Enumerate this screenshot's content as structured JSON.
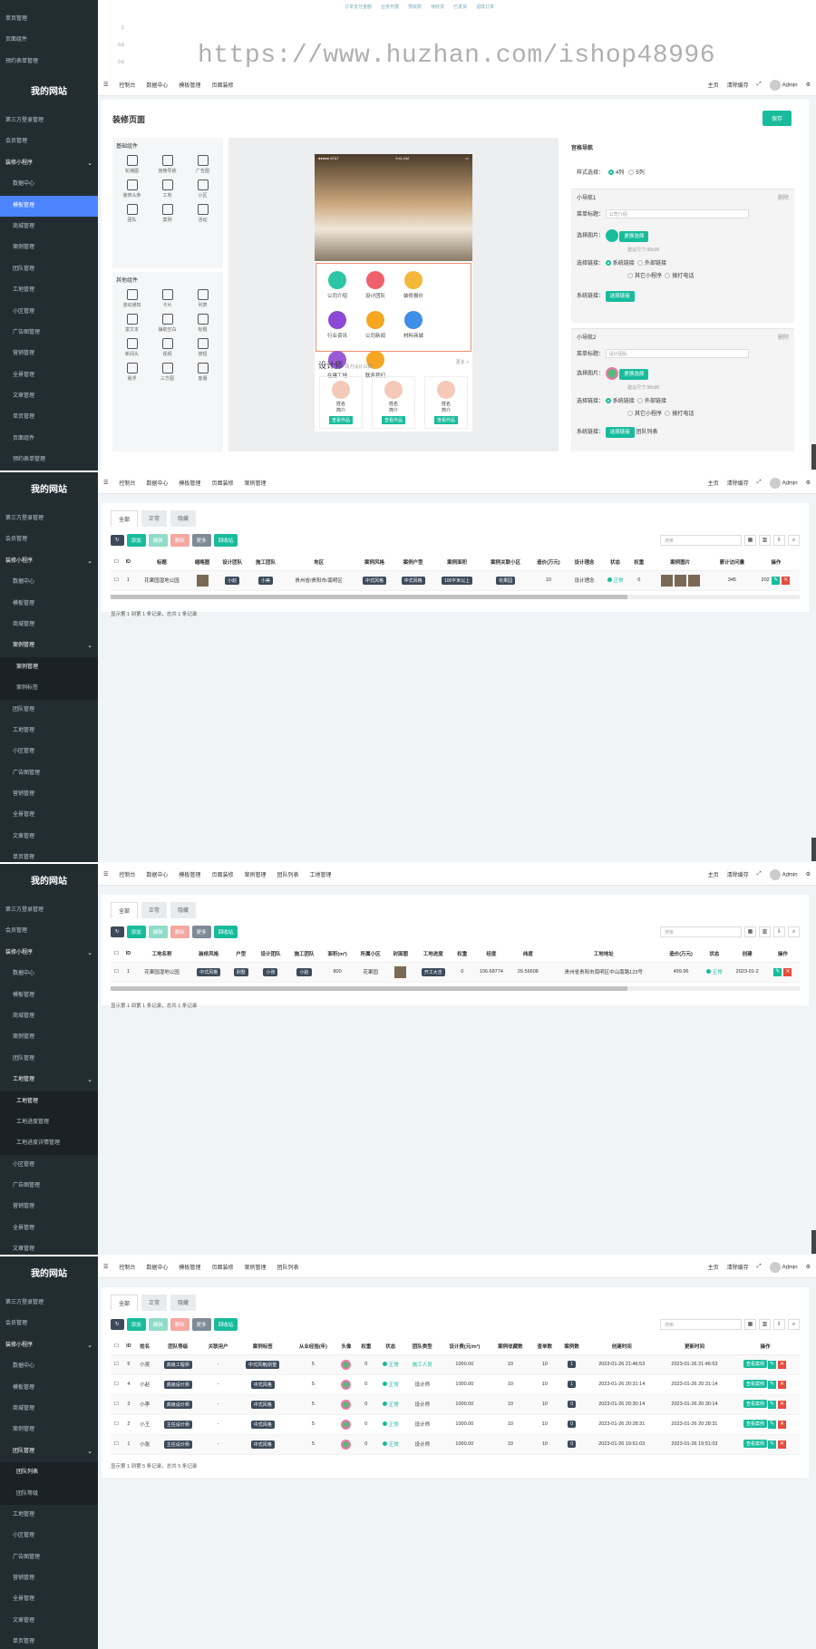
{
  "watermark": "https://www.huzhan.com/ishop48996",
  "brand": "我的网站",
  "top_legend": [
    "订单支付金额",
    "业务开展",
    "预收款",
    "待收货",
    "已发货",
    "退款订单"
  ],
  "top_chart_ticks": [
    "1",
    "0.8",
    "0.6"
  ],
  "top_menu": [
    "单页管理",
    "页面组件",
    "预约表单管理"
  ],
  "topbar_right": {
    "home": "主页",
    "clear": "清除缓存",
    "admin": "Admin"
  },
  "panel1": {
    "tabs": [
      "控制台",
      "数据中心",
      "模板管理",
      "页面装修"
    ],
    "sidebar": [
      "第三方登录管理",
      "会员管理",
      "装修小程序",
      "数据中心",
      "模板管理",
      "商城管理",
      "案例管理",
      "团队管理",
      "工地管理",
      "小区管理",
      "广告图管理",
      "营销管理",
      "全景管理",
      "文章管理",
      "单页管理",
      "页面组件",
      "预约表单管理"
    ],
    "title": "装修页面",
    "save": "保存",
    "basic_h": "基础组件",
    "basic": [
      "轮播图",
      "宫格导航",
      "广告图",
      "装修头条",
      "工地",
      "小区",
      "团队",
      "案例",
      "活动"
    ],
    "other_h": "其他组件",
    "other": [
      "滚动通知",
      "卡片",
      "列表",
      "富文本",
      "辅助空白",
      "标题",
      "新闻头",
      "视频",
      "按钮",
      "悬浮",
      "三方图",
      "客服"
    ],
    "phone": {
      "carrier": "●●●●● AT&T",
      "time": "9:41 AM",
      "quick": [
        "公司介绍",
        "设计团队",
        "装修报价",
        "行业资讯",
        "公司新闻",
        "材料商城",
        "在建工地",
        "联系我们"
      ],
      "des_title": "设计师",
      "des_sub": "百万设计口碑",
      "more": "更多 >",
      "card_name": "姓名",
      "card_role": "简介",
      "card_btn": "查看作品"
    },
    "settings": {
      "head": "宫格导航",
      "style_label": "样式选择：",
      "style_opts": [
        "4列",
        "5列"
      ],
      "nav1": "小导航1",
      "nav2": "小导航2",
      "del": "删除",
      "menu_label": "菜单标题：",
      "menu_val1": "公司介绍",
      "menu_val2": "设计团队",
      "img_label": "选择图片：",
      "img_btn": "更换选择",
      "img_hint": "建议尺寸:98x98",
      "link_label": "选择链接：",
      "link_opts": [
        "系统链接",
        "外部链接",
        "其它小程序",
        "拨打电话"
      ],
      "sys_label": "系统链接：",
      "sys_btn": "选择链接",
      "sys_val": "团队列表"
    }
  },
  "panel2": {
    "tabs": [
      "控制台",
      "数据中心",
      "模板管理",
      "页面装修",
      "案例管理"
    ],
    "sidebar": [
      "第三方登录管理",
      "会员管理",
      "装修小程序",
      "数据中心",
      "模板管理",
      "商城管理",
      "案例管理",
      "案例管理",
      "案例标签",
      "团队管理",
      "工地管理",
      "小区管理",
      "广告图管理",
      "营销管理",
      "全景管理",
      "文章管理",
      "单页管理"
    ],
    "list_tabs": [
      "全部",
      "正常",
      "隐藏"
    ],
    "buttons": [
      "添加",
      "编辑",
      "删除",
      "更多",
      "回收站"
    ],
    "search": "搜索",
    "headers": [
      "ID",
      "标题",
      "缩略图",
      "设计团队",
      "施工团队",
      "地区",
      "案例风格",
      "案例户型",
      "案例面积",
      "案例关联小区",
      "造价(万元)",
      "设计理念",
      "状态",
      "权重",
      "案例图片",
      "累计访问量",
      "操作"
    ],
    "row": [
      "1",
      "花果园湿地公园",
      "",
      "小赵",
      "小美",
      "贵州省/贵阳市/南明区",
      "中式风格",
      "中式风格",
      "100平米以上",
      "花果园",
      "10",
      "设计理念",
      "正常",
      "0",
      "",
      "345",
      "202"
    ],
    "footer": "显示第 1 到第 1 条记录，总共 1 条记录"
  },
  "panel3": {
    "tabs": [
      "控制台",
      "数据中心",
      "模板管理",
      "页面装修",
      "案例管理",
      "团队列表",
      "工地管理"
    ],
    "sidebar": [
      "第三方登录管理",
      "会员管理",
      "装修小程序",
      "数据中心",
      "模板管理",
      "商城管理",
      "案例管理",
      "团队管理",
      "工地管理",
      "工地管理",
      "工地进度管理",
      "工地进度详情管理",
      "小区管理",
      "广告图管理",
      "营销管理",
      "全景管理",
      "文章管理"
    ],
    "headers": [
      "ID",
      "工地名称",
      "装修风格",
      "户型",
      "设计团队",
      "施工团队",
      "面积(m²)",
      "所属小区",
      "封面图",
      "工地进度",
      "权重",
      "经度",
      "纬度",
      "工地地址",
      "造价(万元)",
      "状态",
      "创建",
      "操作"
    ],
    "row": [
      "1",
      "花果园湿地公园",
      "中式风格",
      "别墅",
      "小张",
      "小赵",
      "800",
      "花果园",
      "",
      "开工大吉",
      "0",
      "106.68774",
      "26.56608",
      "贵州省贵阳市南明区中山南路123号",
      "499.96",
      "正常",
      "2023-01-2"
    ],
    "footer": "显示第 1 到第 1 条记录，总共 1 条记录"
  },
  "panel4": {
    "tabs": [
      "控制台",
      "数据中心",
      "模板管理",
      "页面装修",
      "案例管理",
      "团队列表"
    ],
    "sidebar": [
      "第三方登录管理",
      "会员管理",
      "装修小程序",
      "数据中心",
      "模板管理",
      "商城管理",
      "案例管理",
      "团队管理",
      "团队列表",
      "团队等级",
      "工地管理",
      "小区管理",
      "广告图管理",
      "营销管理",
      "全景管理",
      "文章管理",
      "单页管理"
    ],
    "headers": [
      "ID",
      "姓名",
      "团队等级",
      "关联用户",
      "案例标签",
      "从业经验(年)",
      "头像",
      "权重",
      "状态",
      "团队类型",
      "设计费(元/m²)",
      "案例收藏数",
      "查单数",
      "案例数",
      "创建时间",
      "更新时间",
      "操作"
    ],
    "rows": [
      [
        "5",
        "小吴",
        "高级工程师",
        "-",
        "中式风格|别墅",
        "5",
        "",
        "0",
        "正常",
        "施工人员",
        "1000.00",
        "10",
        "10",
        "1",
        "2023-01-26 21:46:53",
        "2023-01-26 21:46:53"
      ],
      [
        "4",
        "小赵",
        "高级设计师",
        "-",
        "中式风格",
        "5",
        "",
        "0",
        "正常",
        "设计师",
        "1000.00",
        "10",
        "10",
        "1",
        "2023-01-26 20:31:14",
        "2023-01-26 20:31:14"
      ],
      [
        "3",
        "小李",
        "高级设计师",
        "-",
        "中式风格",
        "5",
        "",
        "0",
        "正常",
        "设计师",
        "1000.00",
        "10",
        "10",
        "0",
        "2023-01-26 20:30:14",
        "2023-01-26 20:30:14"
      ],
      [
        "2",
        "小王",
        "主任设计师",
        "-",
        "中式风格",
        "5",
        "",
        "0",
        "正常",
        "设计师",
        "1000.00",
        "10",
        "10",
        "0",
        "2023-01-26 20:28:31",
        "2023-01-26 20:28:31"
      ],
      [
        "1",
        "小张",
        "主任设计师",
        "-",
        "中式风格",
        "5",
        "",
        "0",
        "正常",
        "设计师",
        "1000.00",
        "10",
        "10",
        "0",
        "2023-01-26 19:51:03",
        "2023-01-26 19:51:03"
      ]
    ],
    "row_btn": "查看案例",
    "footer": "显示第 1 到第 5 条记录，总共 5 条记录"
  }
}
